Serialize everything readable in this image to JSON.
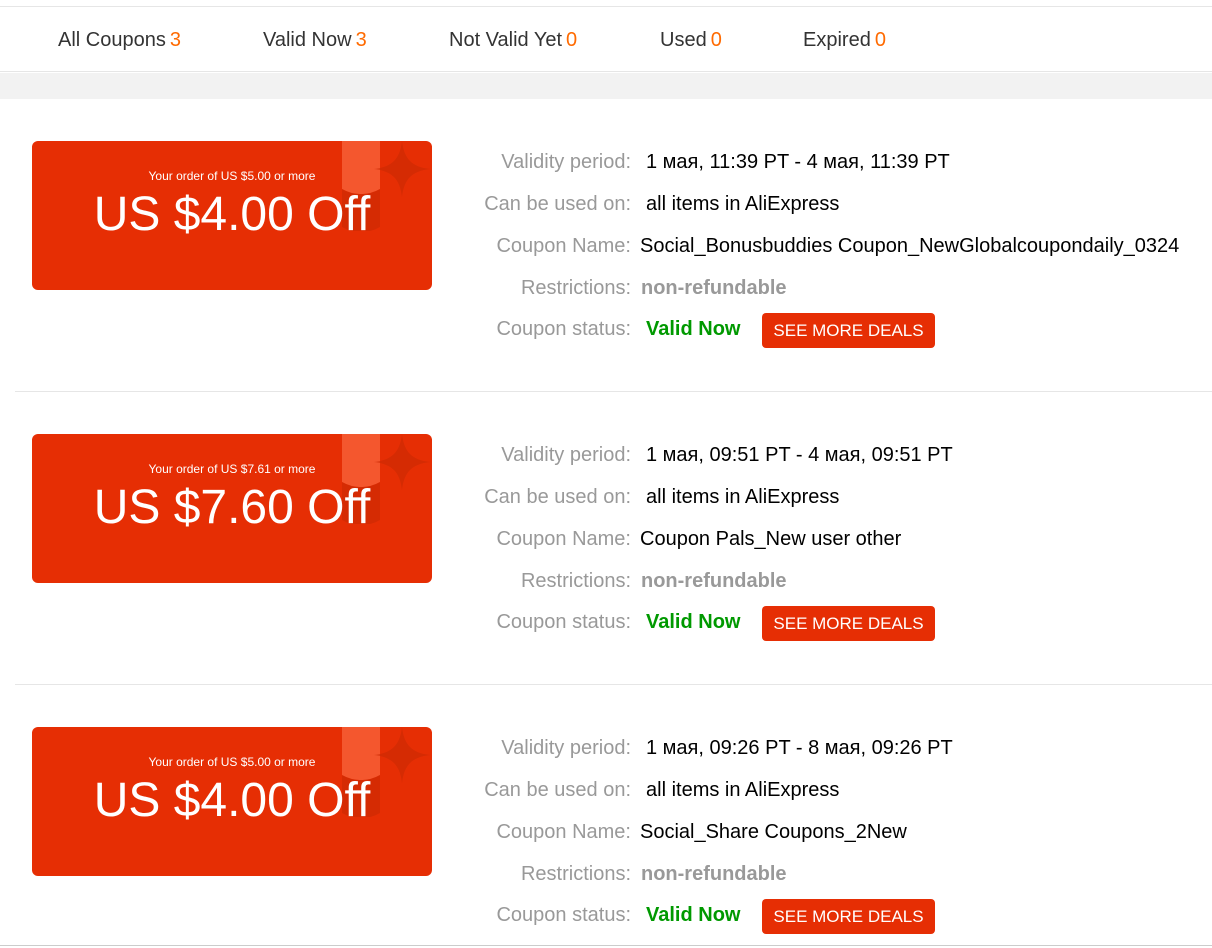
{
  "tabs": [
    {
      "label": "All Coupons",
      "count": "3"
    },
    {
      "label": "Valid Now",
      "count": "3"
    },
    {
      "label": "Not Valid Yet",
      "count": "0"
    },
    {
      "label": "Used",
      "count": "0"
    },
    {
      "label": "Expired",
      "count": "0"
    }
  ],
  "labels": {
    "validity": "Validity period:",
    "usage": "Can be used on:",
    "name": "Coupon Name:",
    "restrictions": "Restrictions:",
    "status": "Coupon status:"
  },
  "coupons": [
    {
      "condition": "Your order of US $5.00 or more",
      "amount": "US $4.00 Off",
      "validity": "1 мая, 11:39 PT - 4 мая, 11:39 PT",
      "usage": "all items in AliExpress",
      "name": "Social_Bonusbuddies Coupon_NewGlobalcoupondaily_0324",
      "restrictions": "non-refundable",
      "status": "Valid Now",
      "button": "SEE MORE DEALS"
    },
    {
      "condition": "Your order of US $7.61 or more",
      "amount": "US $7.60 Off",
      "validity": "1 мая, 09:51 PT - 4 мая, 09:51 PT",
      "usage": "all items in AliExpress",
      "name": "Coupon Pals_New user other",
      "restrictions": "non-refundable",
      "status": "Valid Now",
      "button": "SEE MORE DEALS"
    },
    {
      "condition": "Your order of US $5.00 or more",
      "amount": "US $4.00 Off",
      "validity": "1 мая, 09:26 PT - 8 мая, 09:26 PT",
      "usage": "all items in AliExpress",
      "name": "Social_Share Coupons_2New",
      "restrictions": "non-refundable",
      "status": "Valid Now",
      "button": "SEE MORE DEALS"
    }
  ],
  "colors": {
    "accent": "#e62e04",
    "count": "#ff6a00",
    "status_valid": "#009900",
    "label_gray": "#999999"
  }
}
